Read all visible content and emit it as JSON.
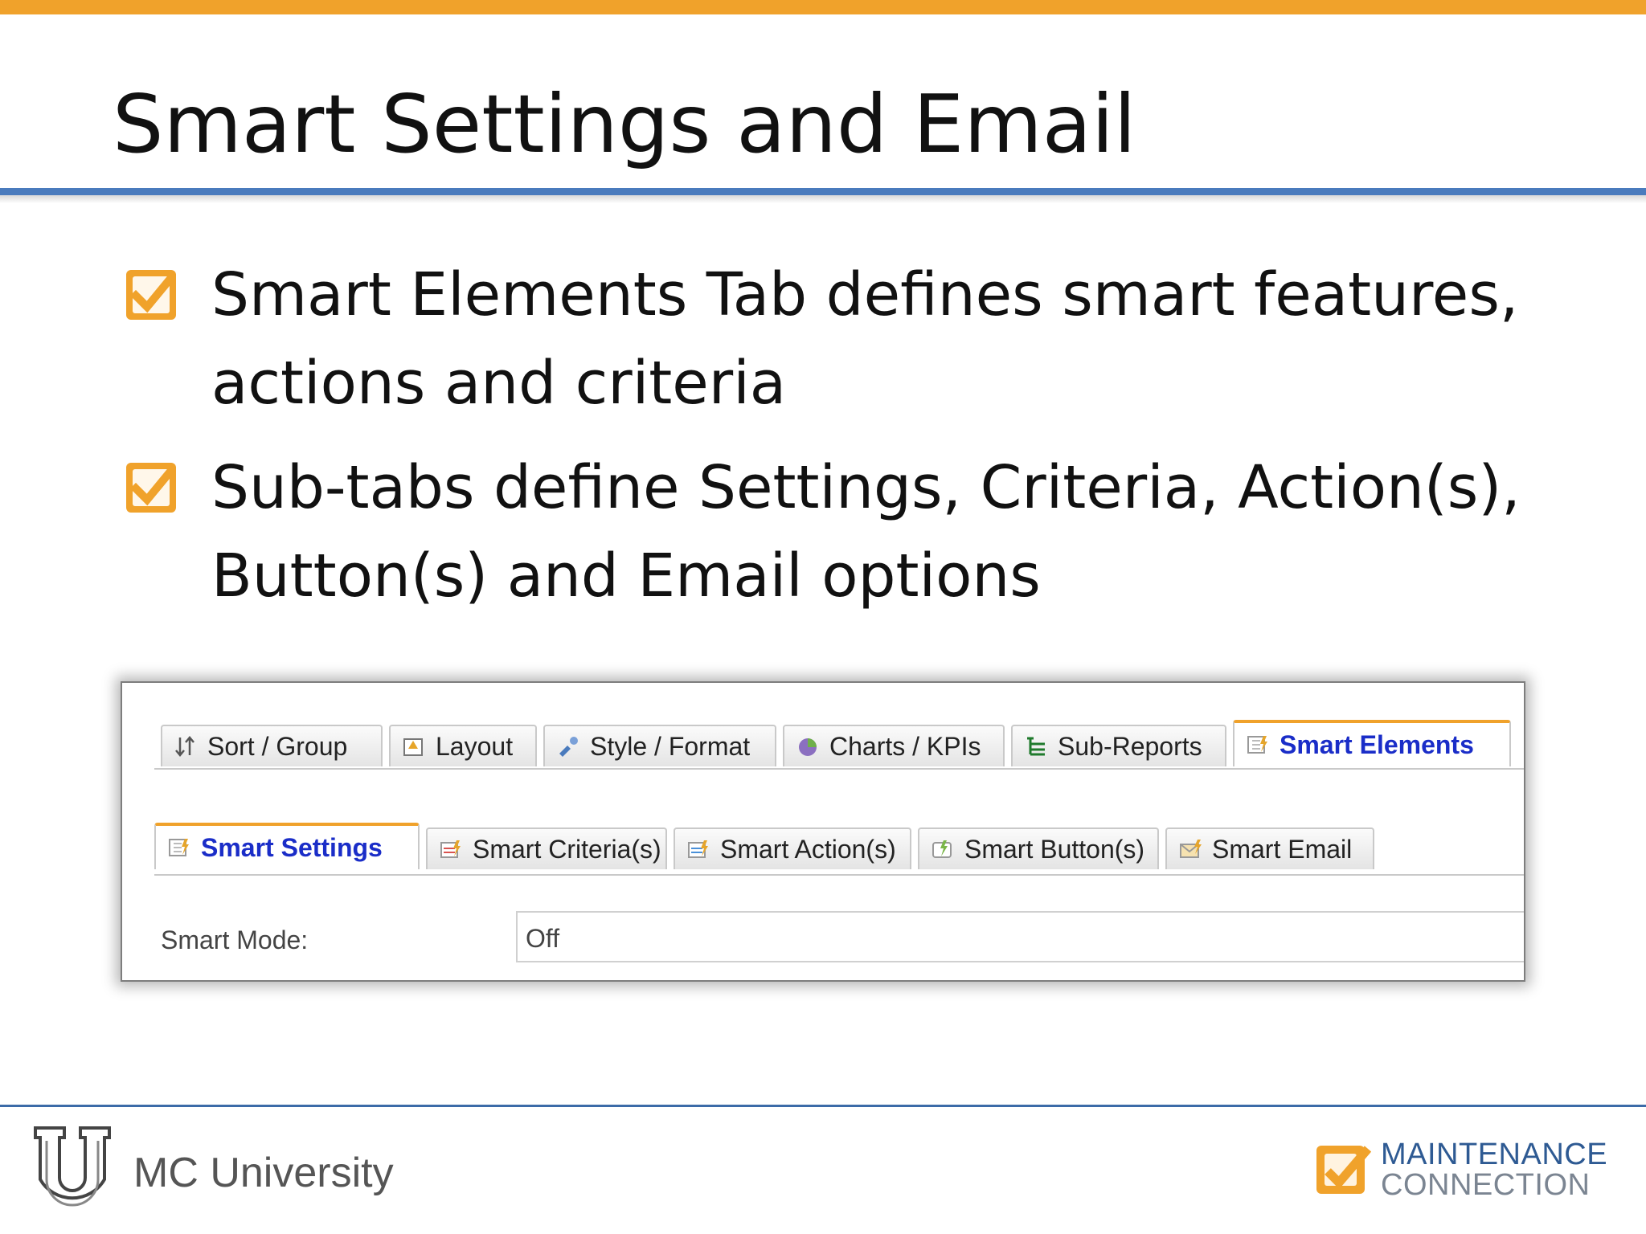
{
  "slide": {
    "title": "Smart Settings and Email",
    "bullets": [
      "Smart Elements Tab defines smart features, actions and criteria",
      "Sub-tabs define Settings, Criteria, Action(s), Button(s) and Email options"
    ]
  },
  "screenshot": {
    "main_tabs": [
      {
        "label": "Sort / Group",
        "icon": "sort-group-icon",
        "active": false
      },
      {
        "label": "Layout",
        "icon": "layout-icon",
        "active": false
      },
      {
        "label": "Style / Format",
        "icon": "style-format-icon",
        "active": false
      },
      {
        "label": "Charts / KPIs",
        "icon": "charts-kpis-icon",
        "active": false
      },
      {
        "label": "Sub-Reports",
        "icon": "sub-reports-icon",
        "active": false
      },
      {
        "label": "Smart Elements",
        "icon": "smart-elements-icon",
        "active": true
      }
    ],
    "sub_tabs": [
      {
        "label": "Smart Settings",
        "icon": "smart-settings-icon",
        "active": true
      },
      {
        "label": "Smart Criteria(s)",
        "icon": "smart-criteria-icon",
        "active": false
      },
      {
        "label": "Smart Action(s)",
        "icon": "smart-action-icon",
        "active": false
      },
      {
        "label": "Smart Button(s)",
        "icon": "smart-button-icon",
        "active": false
      },
      {
        "label": "Smart Email",
        "icon": "smart-email-icon",
        "active": false
      }
    ],
    "smart_mode": {
      "label": "Smart Mode:",
      "value": "Off"
    }
  },
  "footer": {
    "university": "MC University",
    "brand_line1": "MAINTENANCE",
    "brand_line2": "CONNECTION"
  },
  "colors": {
    "accent_orange": "#f0a22b",
    "rule_blue": "#4a7bbd",
    "active_tab_text": "#1a2dc8"
  }
}
